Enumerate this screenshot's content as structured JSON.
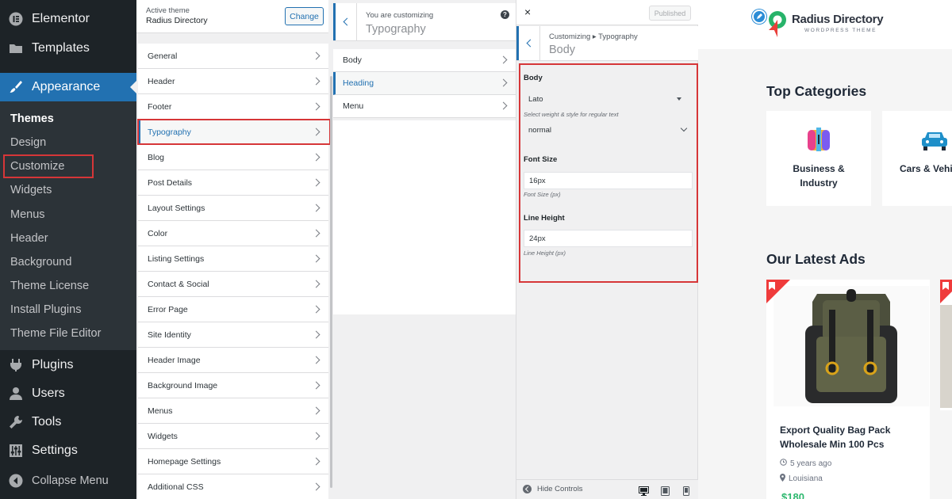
{
  "admin_menu": {
    "items": [
      {
        "label": "Elementor",
        "icon": "elementor-icon"
      },
      {
        "label": "Templates",
        "icon": "folder-icon"
      },
      {
        "label": "Appearance",
        "icon": "paintbrush-icon"
      },
      {
        "label": "Plugins",
        "icon": "plugin-icon"
      },
      {
        "label": "Users",
        "icon": "user-icon"
      },
      {
        "label": "Tools",
        "icon": "wrench-icon"
      },
      {
        "label": "Settings",
        "icon": "settings-sliders-icon"
      },
      {
        "label": "Collapse Menu",
        "icon": "collapse-arrow-icon"
      }
    ],
    "appearance_submenu": [
      "Themes",
      "Design",
      "Customize",
      "Widgets",
      "Menus",
      "Header",
      "Background",
      "Theme License",
      "Install Plugins",
      "Theme File Editor"
    ]
  },
  "customizer": {
    "active_theme_label": "Active theme",
    "active_theme_name": "Radius Directory",
    "change_label": "Change",
    "panels": [
      "General",
      "Header",
      "Footer",
      "Typography",
      "Blog",
      "Post Details",
      "Layout Settings",
      "Color",
      "Listing Settings",
      "Contact & Social",
      "Error Page",
      "Site Identity",
      "Header Image",
      "Background Image",
      "Menus",
      "Widgets",
      "Homepage Settings",
      "Additional CSS"
    ],
    "section_header_small": "You are customizing",
    "section_header_title": "Typography",
    "sections": [
      "Body",
      "Heading",
      "Menu"
    ],
    "close_symbol": "×",
    "published_label": "Published",
    "control_header_small": "Customizing ▸ Typography",
    "control_header_title": "Body",
    "body_label": "Body",
    "font_family_value": "Lato",
    "weight_desc": "Select weight & style for regular text",
    "weight_value": "normal",
    "font_size_label": "Font Size",
    "font_size_value": "16px",
    "font_size_desc": "Font Size (px)",
    "line_height_label": "Line Height",
    "line_height_value": "24px",
    "line_height_desc": "Line Height (px)",
    "hide_controls_label": "Hide Controls"
  },
  "preview": {
    "brand_name": "Radius Directory",
    "brand_tagline": "WORDPRESS THEME",
    "top_categories_heading": "Top Categories",
    "categories": [
      {
        "label_line1": "Business &",
        "label_line2": "Industry"
      },
      {
        "label_line1": "Cars & Vehi",
        "label_line2": ""
      }
    ],
    "latest_ads_heading": "Our Latest Ads",
    "ad": {
      "title_line1": "Export Quality Bag Pack",
      "title_line2": "Wholesale Min 100 Pcs",
      "time": "5 years ago",
      "location": "Louisiana",
      "price": "$180"
    }
  },
  "colors": {
    "admin_bg": "#1d2327",
    "accent": "#2271b1",
    "highlight_red": "#d63638",
    "price_green": "#2eb86f"
  }
}
